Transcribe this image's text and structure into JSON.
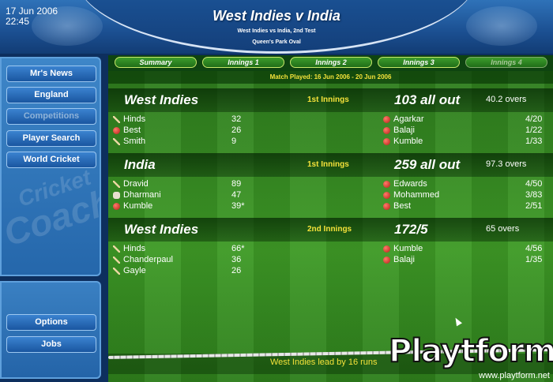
{
  "header": {
    "date": "17 Jun 2006",
    "time": "22:45",
    "title": "West Indies v India",
    "subtitle": "West Indies vs India, 2nd Test",
    "venue": "Queen's Park Oval"
  },
  "sidebar": {
    "buttons": [
      "Mr's News",
      "England",
      "Competitions",
      "Player Search",
      "World Cricket"
    ],
    "bottom_buttons": [
      "Options",
      "Jobs"
    ],
    "watermark_1": "Cricket",
    "watermark_2": "Coach"
  },
  "tabs": [
    "Summary",
    "Innings 1",
    "Innings 2",
    "Innings 3",
    "Innings 4"
  ],
  "match_played": "Match Played: 16 Jun 2006 - 20 Jun 2006",
  "innings": [
    {
      "team": "West Indies",
      "label": "1st Innings",
      "score": "103 all out",
      "overs": "40.2 overs",
      "batting": [
        {
          "name": "Hinds",
          "runs": "32",
          "icon": "bat-icon"
        },
        {
          "name": "Best",
          "runs": "26",
          "icon": "ball-icon"
        },
        {
          "name": "Smith",
          "runs": "9",
          "icon": "bat-icon"
        }
      ],
      "bowling": [
        {
          "name": "Agarkar",
          "figures": "4/20"
        },
        {
          "name": "Balaji",
          "figures": "1/22"
        },
        {
          "name": "Kumble",
          "figures": "1/33"
        }
      ]
    },
    {
      "team": "India",
      "label": "1st Innings",
      "score": "259 all out",
      "overs": "97.3 overs",
      "batting": [
        {
          "name": "Dravid",
          "runs": "89",
          "icon": "bat-icon"
        },
        {
          "name": "Dharmani",
          "runs": "47",
          "icon": "glove-icon"
        },
        {
          "name": "Kumble",
          "runs": "39*",
          "icon": "ball-icon"
        }
      ],
      "bowling": [
        {
          "name": "Edwards",
          "figures": "4/50"
        },
        {
          "name": "Mohammed",
          "figures": "3/83"
        },
        {
          "name": "Best",
          "figures": "2/51"
        }
      ]
    },
    {
      "team": "West Indies",
      "label": "2nd Innings",
      "score": "172/5",
      "overs": "65 overs",
      "batting": [
        {
          "name": "Hinds",
          "runs": "66*",
          "icon": "bat-icon"
        },
        {
          "name": "Chanderpaul",
          "runs": "36",
          "icon": "bat-icon"
        },
        {
          "name": "Gayle",
          "runs": "26",
          "icon": "bat-icon"
        }
      ],
      "bowling": [
        {
          "name": "Kumble",
          "figures": "4/56"
        },
        {
          "name": "Balaji",
          "figures": "1/35"
        }
      ]
    }
  ],
  "lead_text": "West Indies lead by 16 runs",
  "logo": {
    "text": "Playtform",
    "url": "www.playtform.net"
  }
}
